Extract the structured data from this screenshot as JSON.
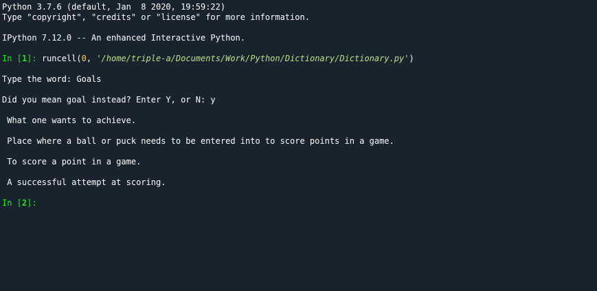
{
  "banner": {
    "python_version_line": "Python 3.7.6 (default, Jan  8 2020, 19:59:22)",
    "help_line": "Type \"copyright\", \"credits\" or \"license\" for more information.",
    "ipython_line": "IPython 7.12.0 -- An enhanced Interactive Python."
  },
  "cell1": {
    "prompt_prefix": "In [",
    "prompt_number": "1",
    "prompt_suffix": "]: ",
    "func": "runcell(",
    "num_arg": "0",
    "sep": ", ",
    "str_arg": "'/home/triple-a/Documents/Work/Python/Dictionary/Dictionary.py'",
    "close": ")"
  },
  "output": {
    "type_word_line": "Type the word: Goals",
    "did_you_mean_line": "Did you mean goal instead? Enter Y, or N: y",
    "definitions": [
      " What one wants to achieve.",
      " Place where a ball or puck needs to be entered into to score points in a game.",
      " To score a point in a game.",
      " A successful attempt at scoring."
    ]
  },
  "cell2": {
    "prompt_prefix": "In [",
    "prompt_number": "2",
    "prompt_suffix": "]: "
  },
  "colors": {
    "background": "#19232d",
    "text": "#ffffff",
    "prompt": "#13ef13",
    "number_literal": "#f4cf5a",
    "string_literal": "#b6e08a"
  }
}
